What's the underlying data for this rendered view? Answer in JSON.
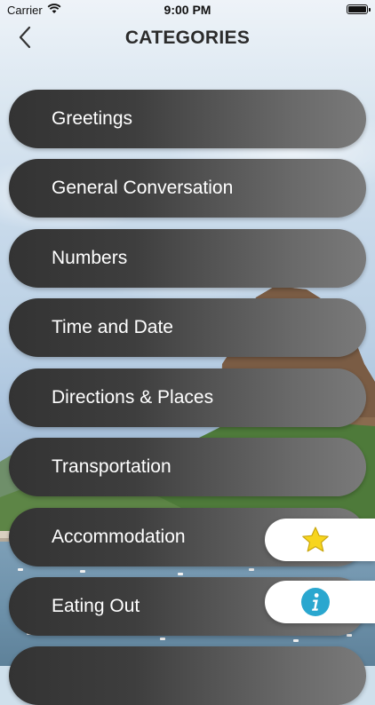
{
  "status_bar": {
    "carrier": "Carrier",
    "time": "9:00 PM"
  },
  "nav": {
    "title": "CATEGORIES",
    "back_icon": "chevron-left-icon"
  },
  "categories": [
    {
      "label": "Greetings"
    },
    {
      "label": "General Conversation"
    },
    {
      "label": "Numbers"
    },
    {
      "label": "Time and Date"
    },
    {
      "label": "Directions & Places"
    },
    {
      "label": "Transportation"
    },
    {
      "label": "Accommodation"
    },
    {
      "label": "Eating Out"
    },
    {
      "label": ""
    }
  ],
  "side_buttons": {
    "favorites_icon": "star-icon",
    "info_icon": "info-icon"
  },
  "colors": {
    "pill_dark": "#333333",
    "pill_light": "#7a7a7a",
    "star": "#f7d51d",
    "info": "#2aa7cf",
    "title": "#2b2b2b"
  }
}
